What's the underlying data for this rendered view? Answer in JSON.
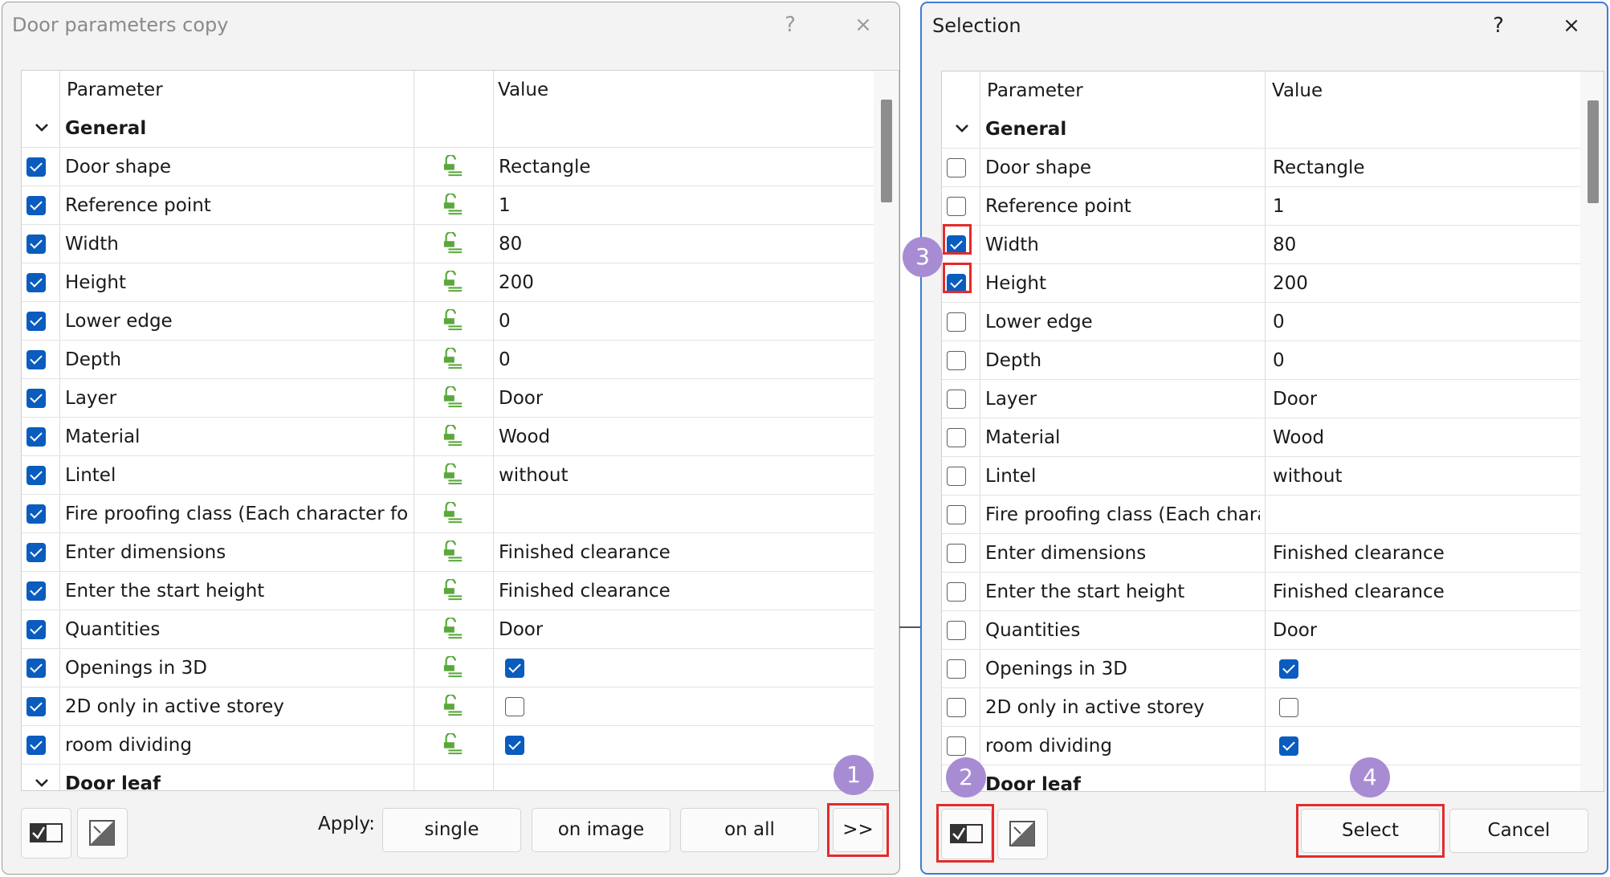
{
  "left_dialog": {
    "title": "Door parameters copy",
    "help_label": "?",
    "close_label": "×",
    "columns": [
      "Parameter",
      "Value"
    ],
    "group_general": "General",
    "group_door_leaf": "Door leaf",
    "rows": [
      {
        "param": "Door shape",
        "value": "Rectangle",
        "checked": true
      },
      {
        "param": "Reference point",
        "value": "1",
        "checked": true
      },
      {
        "param": "Width",
        "value": "80",
        "checked": true
      },
      {
        "param": "Height",
        "value": "200",
        "checked": true
      },
      {
        "param": "Lower edge",
        "value": "0",
        "checked": true
      },
      {
        "param": "Depth",
        "value": "0",
        "checked": true
      },
      {
        "param": "Layer",
        "value": "Door",
        "checked": true
      },
      {
        "param": "Material",
        "value": "Wood",
        "checked": true
      },
      {
        "param": "Lintel",
        "value": "without",
        "checked": true
      },
      {
        "param": "Fire proofing class (Each character follo...",
        "value": "",
        "checked": true
      },
      {
        "param": "Enter dimensions",
        "value": "Finished clearance",
        "checked": true
      },
      {
        "param": "Enter the start height",
        "value": "Finished clearance",
        "checked": true
      },
      {
        "param": "Quantities",
        "value": "Door",
        "checked": true
      },
      {
        "param": "Openings in 3D",
        "value_checkbox": true,
        "checked": true
      },
      {
        "param": "2D only in active storey",
        "value_checkbox": false,
        "checked": true
      },
      {
        "param": "room dividing",
        "value_checkbox": true,
        "checked": true
      }
    ],
    "apply_label": "Apply:",
    "buttons": {
      "single": "single",
      "on_image": "on image",
      "on_all": "on all",
      "more": ">>"
    }
  },
  "right_dialog": {
    "title": "Selection",
    "help_label": "?",
    "close_label": "×",
    "columns": [
      "Parameter",
      "Value"
    ],
    "group_general": "General",
    "group_door_leaf": "Door leaf",
    "rows": [
      {
        "param": "Door shape",
        "value": "Rectangle",
        "checked": false
      },
      {
        "param": "Reference point",
        "value": "1",
        "checked": false
      },
      {
        "param": "Width",
        "value": "80",
        "checked": true
      },
      {
        "param": "Height",
        "value": "200",
        "checked": true
      },
      {
        "param": "Lower edge",
        "value": "0",
        "checked": false
      },
      {
        "param": "Depth",
        "value": "0",
        "checked": false
      },
      {
        "param": "Layer",
        "value": "Door",
        "checked": false
      },
      {
        "param": "Material",
        "value": "Wood",
        "checked": false
      },
      {
        "param": "Lintel",
        "value": "without",
        "checked": false
      },
      {
        "param": "Fire proofing class (Each charact...",
        "value": "",
        "checked": false
      },
      {
        "param": "Enter dimensions",
        "value": "Finished clearance",
        "checked": false
      },
      {
        "param": "Enter the start height",
        "value": "Finished clearance",
        "checked": false
      },
      {
        "param": "Quantities",
        "value": "Door",
        "checked": false
      },
      {
        "param": "Openings in 3D",
        "value_checkbox": true,
        "checked": false
      },
      {
        "param": "2D only in active storey",
        "value_checkbox": false,
        "checked": false
      },
      {
        "param": "room dividing",
        "value_checkbox": true,
        "checked": false
      }
    ],
    "buttons": {
      "select": "Select",
      "cancel": "Cancel"
    }
  },
  "annotations": {
    "step1": "1",
    "step2": "2",
    "step3": "3",
    "step4": "4"
  },
  "colors": {
    "checkbox_checked": "#0a5cbe",
    "highlight_red": "#e32b2b",
    "badge_purple": "#a88cd3",
    "lock_green": "#5aa83c",
    "focus_border": "#3d7bd9"
  }
}
